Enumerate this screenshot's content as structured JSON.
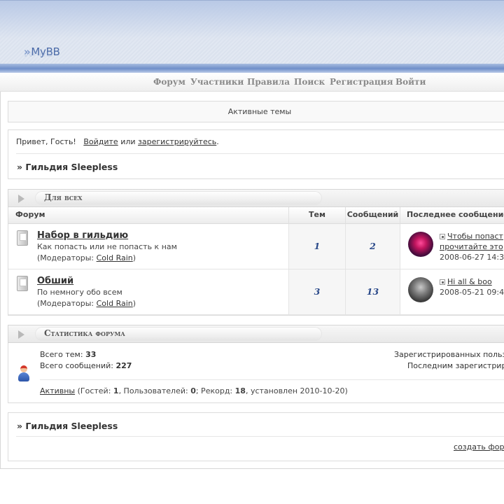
{
  "site": {
    "logo_text": "MyBB",
    "logo_chevrons": "»"
  },
  "nav": {
    "items": [
      {
        "label": "Форум"
      },
      {
        "label": "Участники"
      },
      {
        "label": "Правила"
      },
      {
        "label": "Поиск"
      },
      {
        "label": "Регистрация"
      },
      {
        "label": "Войти"
      }
    ]
  },
  "active_topics": {
    "label": "Активные темы"
  },
  "welcome": {
    "greeting": "Привет, Гость!",
    "login_link": "Войдите",
    "or_text": "или",
    "register_link": "зарегистрируйтесь",
    "period": "."
  },
  "breadcrumb": {
    "label": "» Гильдия Sleepless"
  },
  "category": {
    "title": "Для всех",
    "headers": {
      "forum": "Форум",
      "threads": "Тем",
      "posts": "Сообщений",
      "last_post": "Последнее сообщение"
    },
    "forums": [
      {
        "name": "Набор в гильдию",
        "description": "Как попасть или не попасть к нам",
        "mods_prefix": "(Модераторы: ",
        "mods_name": "Cold Rain",
        "mods_suffix": ")",
        "threads": "1",
        "posts": "2",
        "last_title_line1": "Чтобы попаст",
        "last_title_line2": "прочитайте это",
        "last_date": "2008-06-27 14:3"
      },
      {
        "name": "Обший",
        "description": "По немногу обо всем",
        "mods_prefix": "(Модераторы: ",
        "mods_name": "Cold Rain",
        "mods_suffix": ")",
        "threads": "3",
        "posts": "13",
        "last_title_line1": "Hi all & boo",
        "last_date": "2008-05-21 09:4"
      }
    ]
  },
  "stats": {
    "title": "Статистика форума",
    "total_topics_label": "Всего тем:",
    "total_topics": "33",
    "total_posts_label": "Всего сообщений:",
    "total_posts": "227",
    "registered_users_label": "Зарегистрированных польз",
    "last_registered_label": "Последним зарегистрир",
    "online_link": "Активны",
    "online_text_1": " (Гостей: ",
    "guests": "1",
    "online_text_2": ", Пользователей: ",
    "users": "0",
    "online_text_3": "; Рекорд: ",
    "record": "18",
    "online_text_4": ", установлен 2010-10-20)"
  },
  "footer": {
    "breadcrumb": "» Гильдия Sleepless",
    "create_forum_link": "создать фор"
  },
  "colors": {
    "accent": "#2b4a8a",
    "header_band": "#6f8fc9"
  },
  "icons": [
    "forum-status-icon",
    "last-post-icon",
    "user-stats-icon",
    "category-collapse-arrow-icon"
  ]
}
